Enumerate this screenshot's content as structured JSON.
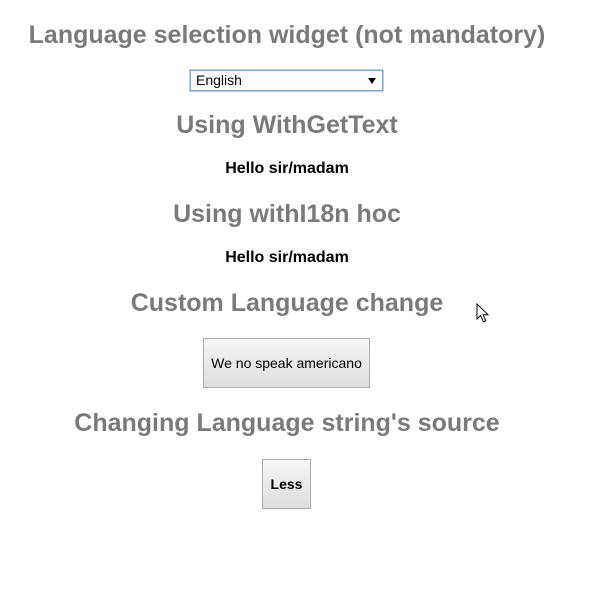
{
  "language_widget": {
    "heading": "Language selection widget (not mandatory)",
    "selected_language": "English"
  },
  "gettext_section": {
    "heading": "Using WithGetText",
    "greeting": "Hello sir/madam"
  },
  "i18n_section": {
    "heading": "Using withI18n hoc",
    "greeting": "Hello sir/madam"
  },
  "custom_change_section": {
    "heading": "Custom Language change",
    "button_label": "We no speak americano"
  },
  "source_section": {
    "heading": "Changing Language string's source",
    "button_label": "Less"
  },
  "icons": {
    "select_arrow": "chevron-down-icon",
    "pointer": "mouse-cursor-icon"
  },
  "colors": {
    "heading": "#7a7a7a",
    "text": "#000000",
    "select_focus_border": "#7ea6d6",
    "button_border": "#adadad"
  }
}
